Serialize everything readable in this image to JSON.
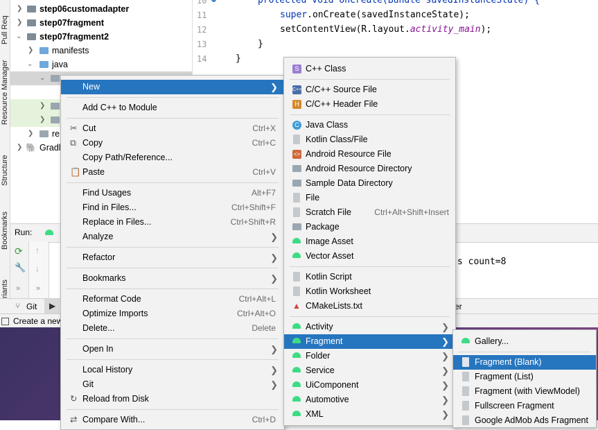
{
  "sidebar": {
    "pull_requests": "Pull Req",
    "resource_manager": "Resource Manager",
    "structure": "Structure",
    "bookmarks": "Bookmarks",
    "variants": "riants"
  },
  "tree": {
    "items": [
      {
        "label": "step06customadapter",
        "bold": true
      },
      {
        "label": "step07fragment",
        "bold": true
      },
      {
        "label": "step07fragment2",
        "bold": true
      },
      {
        "label": "manifests"
      },
      {
        "label": "java"
      },
      {
        "label": "re"
      },
      {
        "label": "Gradl"
      }
    ]
  },
  "editor": {
    "line_numbers": [
      "10",
      "11",
      "12",
      "13",
      "14"
    ],
    "line10": "protected void onCreate(Bundle savedInstanceState) {",
    "line11_kw": "super",
    "line11_rest": ".onCreate(savedInstanceState);",
    "line12_a": "setContentView(R.layout.",
    "line12_b": "activity_main",
    "line12_c": ");",
    "line13": "}",
    "line14": "}"
  },
  "run_panel": {
    "tab_label": "Run:",
    "output_text": "s count=8",
    "git_label": "Git",
    "right_fragment": "er"
  },
  "status": {
    "text": "Create a new"
  },
  "context_menu": {
    "items": [
      {
        "label": "New",
        "submenu": true
      },
      {
        "label": "Add C++ to Module"
      },
      {
        "label": "Cut",
        "shortcut": "Ctrl+X"
      },
      {
        "label": "Copy",
        "shortcut": "Ctrl+C"
      },
      {
        "label": "Copy Path/Reference..."
      },
      {
        "label": "Paste",
        "shortcut": "Ctrl+V"
      },
      {
        "label": "Find Usages",
        "shortcut": "Alt+F7"
      },
      {
        "label": "Find in Files...",
        "shortcut": "Ctrl+Shift+F"
      },
      {
        "label": "Replace in Files...",
        "shortcut": "Ctrl+Shift+R"
      },
      {
        "label": "Analyze",
        "submenu": true
      },
      {
        "label": "Refactor",
        "submenu": true
      },
      {
        "label": "Bookmarks",
        "submenu": true
      },
      {
        "label": "Reformat Code",
        "shortcut": "Ctrl+Alt+L"
      },
      {
        "label": "Optimize Imports",
        "shortcut": "Ctrl+Alt+O"
      },
      {
        "label": "Delete...",
        "shortcut": "Delete"
      },
      {
        "label": "Open In",
        "submenu": true
      },
      {
        "label": "Local History",
        "submenu": true
      },
      {
        "label": "Git",
        "submenu": true
      },
      {
        "label": "Reload from Disk"
      },
      {
        "label": "Compare With...",
        "shortcut": "Ctrl+D"
      }
    ]
  },
  "new_submenu": {
    "items": [
      {
        "label": "C++ Class"
      },
      {
        "label": "C/C++ Source File"
      },
      {
        "label": "C/C++ Header File"
      },
      {
        "label": "Java Class"
      },
      {
        "label": "Kotlin Class/File"
      },
      {
        "label": "Android Resource File"
      },
      {
        "label": "Android Resource Directory"
      },
      {
        "label": "Sample Data Directory"
      },
      {
        "label": "File"
      },
      {
        "label": "Scratch File",
        "shortcut": "Ctrl+Alt+Shift+Insert"
      },
      {
        "label": "Package"
      },
      {
        "label": "Image Asset"
      },
      {
        "label": "Vector Asset"
      },
      {
        "label": "Kotlin Script"
      },
      {
        "label": "Kotlin Worksheet"
      },
      {
        "label": "CMakeLists.txt"
      },
      {
        "label": "Activity",
        "submenu": true
      },
      {
        "label": "Fragment",
        "submenu": true
      },
      {
        "label": "Folder",
        "submenu": true
      },
      {
        "label": "Service",
        "submenu": true
      },
      {
        "label": "UiComponent",
        "submenu": true
      },
      {
        "label": "Automotive",
        "submenu": true
      },
      {
        "label": "XML",
        "submenu": true
      }
    ]
  },
  "fragment_submenu": {
    "items": [
      {
        "label": "Gallery..."
      },
      {
        "label": "Fragment (Blank)"
      },
      {
        "label": "Fragment (List)"
      },
      {
        "label": "Fragment (with ViewModel)"
      },
      {
        "label": "Fullscreen Fragment"
      },
      {
        "label": "Google AdMob Ads Fragment"
      }
    ]
  },
  "colors": {
    "selection": "#2675bf",
    "android_green": "#3ddc84",
    "keyword": "#0033b3",
    "italic_field": "#871094"
  }
}
